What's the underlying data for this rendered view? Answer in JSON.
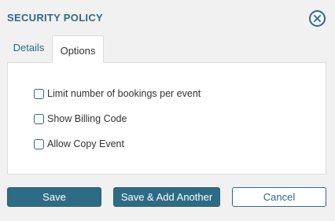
{
  "dialog": {
    "title": "SECURITY POLICY"
  },
  "tabs": [
    {
      "label": "Details",
      "active": false
    },
    {
      "label": "Options",
      "active": true
    }
  ],
  "options": [
    {
      "label": "Limit number of bookings per event",
      "checked": false
    },
    {
      "label": "Show Billing Code",
      "checked": false
    },
    {
      "label": "Allow Copy Event",
      "checked": false
    }
  ],
  "buttons": {
    "save": "Save",
    "save_add": "Save & Add Another",
    "cancel": "Cancel"
  },
  "colors": {
    "accent": "#2e6b84",
    "background": "#f1f1f1",
    "panel": "#ffffff"
  },
  "icons": {
    "close": "close-circle-icon"
  }
}
